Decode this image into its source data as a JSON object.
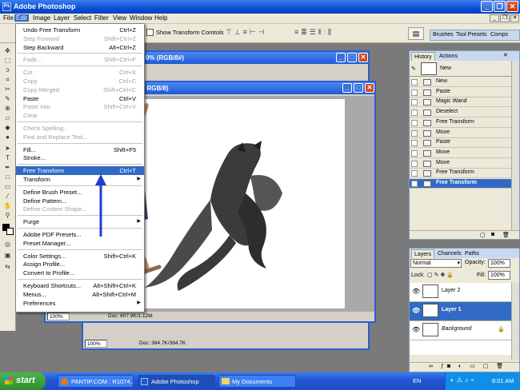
{
  "app": {
    "title": "Adobe Photoshop",
    "icon": "photoshop-icon"
  },
  "menubar": [
    "File",
    "Edit",
    "Image",
    "Layer",
    "Select",
    "Filter",
    "View",
    "Window",
    "Help"
  ],
  "options": {
    "show_transform_controls": "Show Transform Controls",
    "palette_tabs": [
      "Brushes",
      "Tool Presets",
      "Comps"
    ]
  },
  "doc_back": {
    "title": "0% (RGB/8#)",
    "zoom": "100%",
    "doc": "Doc: 364.7K/364.7K"
  },
  "doc_front": {
    "title": ", RGB/8)",
    "zoom": "100%",
    "doc": "Doc: 607.9K/1.12M"
  },
  "edit_menu": [
    {
      "label": "Undo Free Transform",
      "shortcut": "Ctrl+Z",
      "enabled": true
    },
    {
      "label": "Step Forward",
      "shortcut": "Shift+Ctrl+Z",
      "enabled": false
    },
    {
      "label": "Step Backward",
      "shortcut": "Alt+Ctrl+Z",
      "enabled": true
    },
    {
      "sep": true
    },
    {
      "label": "Fade...",
      "shortcut": "Shift+Ctrl+F",
      "enabled": false
    },
    {
      "sep": true
    },
    {
      "label": "Cut",
      "shortcut": "Ctrl+X",
      "enabled": false
    },
    {
      "label": "Copy",
      "shortcut": "Ctrl+C",
      "enabled": false
    },
    {
      "label": "Copy Merged",
      "shortcut": "Shift+Ctrl+C",
      "enabled": false
    },
    {
      "label": "Paste",
      "shortcut": "Ctrl+V",
      "enabled": true
    },
    {
      "label": "Paste Into",
      "shortcut": "Shift+Ctrl+V",
      "enabled": false
    },
    {
      "label": "Clear",
      "shortcut": "",
      "enabled": false
    },
    {
      "sep": true
    },
    {
      "label": "Check Spelling...",
      "shortcut": "",
      "enabled": false
    },
    {
      "label": "Find and Replace Text...",
      "shortcut": "",
      "enabled": false
    },
    {
      "sep": true
    },
    {
      "label": "Fill...",
      "shortcut": "Shift+F5",
      "enabled": true
    },
    {
      "label": "Stroke...",
      "shortcut": "",
      "enabled": true
    },
    {
      "sep": true
    },
    {
      "label": "Free Transform",
      "shortcut": "Ctrl+T",
      "enabled": true,
      "selected": true
    },
    {
      "label": "Transform",
      "shortcut": "",
      "enabled": true,
      "submenu": true
    },
    {
      "sep": true
    },
    {
      "label": "Define Brush Preset...",
      "shortcut": "",
      "enabled": true
    },
    {
      "label": "Define Pattern...",
      "shortcut": "",
      "enabled": true
    },
    {
      "label": "Define Custom Shape...",
      "shortcut": "",
      "enabled": false
    },
    {
      "sep": true
    },
    {
      "label": "Purge",
      "shortcut": "",
      "enabled": true,
      "submenu": true
    },
    {
      "sep": true
    },
    {
      "label": "Adobe PDF Presets...",
      "shortcut": "",
      "enabled": true
    },
    {
      "label": "Preset Manager...",
      "shortcut": "",
      "enabled": true
    },
    {
      "sep": true
    },
    {
      "label": "Color Settings...",
      "shortcut": "Shift+Ctrl+K",
      "enabled": true
    },
    {
      "label": "Assign Profile...",
      "shortcut": "",
      "enabled": true
    },
    {
      "label": "Convert to Profile...",
      "shortcut": "",
      "enabled": true
    },
    {
      "sep": true
    },
    {
      "label": "Keyboard Shortcuts...",
      "shortcut": "Alt+Shift+Ctrl+K",
      "enabled": true
    },
    {
      "label": "Menus...",
      "shortcut": "Alt+Shift+Ctrl+M",
      "enabled": true
    },
    {
      "label": "Preferences",
      "shortcut": "",
      "enabled": true,
      "submenu": true
    }
  ],
  "history": {
    "tabs": [
      "History",
      "Actions"
    ],
    "snapshot": "New",
    "items": [
      "New",
      "Paste",
      "Magic Wand",
      "Deselect",
      "Free Transform",
      "Move",
      "Paste",
      "Move",
      "Move",
      "Free Transform",
      "Free Transform"
    ],
    "selected_index": 10
  },
  "layers": {
    "tabs": [
      "Layers",
      "Channels",
      "Paths"
    ],
    "blend": "Normal",
    "opacity_label": "Opacity:",
    "opacity": "100%",
    "lock_label": "Lock:",
    "fill_label": "Fill:",
    "fill": "100%",
    "items": [
      "Layer 2",
      "Layer 1",
      "Background"
    ],
    "selected_index": 1
  },
  "taskbar": {
    "start": "start",
    "items": [
      "PANTIP.COM : R1074...",
      "Adobe Photoshop",
      "My Documents"
    ],
    "active_index": 1,
    "lang": "EN",
    "clock": "8:01 AM"
  },
  "colors": {
    "accent": "#316ac5",
    "titlebar": "#0a4fd6",
    "arrow": "#1e3fd0"
  }
}
